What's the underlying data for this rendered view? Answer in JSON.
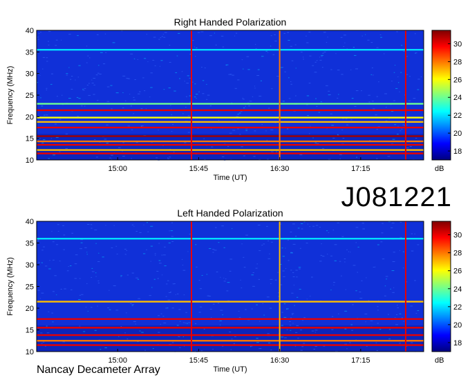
{
  "source_id": "J081221",
  "instrument": "Nancay Decameter Array",
  "colors": {
    "scale": [
      "#00007f",
      "#0000ff",
      "#007fff",
      "#00ffff",
      "#7fff7f",
      "#ffff00",
      "#ff7f00",
      "#ff0000",
      "#7f0000"
    ]
  },
  "chart_data": [
    {
      "type": "heatmap",
      "title": "Right Handed Polarization",
      "xlabel": "Time (UT)",
      "ylabel": "Frequency (MHz)",
      "x_ticks": [
        "15:00",
        "15:45",
        "16:30",
        "17:15"
      ],
      "y_ticks": [
        "40",
        "35",
        "30",
        "25",
        "20",
        "15",
        "10"
      ],
      "ylim": [
        10,
        40
      ],
      "colorbar": {
        "label": "dB",
        "ticks": [
          "30",
          "28",
          "26",
          "24",
          "22",
          "20",
          "18"
        ],
        "range": [
          17,
          31.5
        ]
      },
      "bands": [
        {
          "freq": 11.5,
          "level": 30
        },
        {
          "freq": 12.3,
          "level": 27
        },
        {
          "freq": 13.5,
          "level": 30
        },
        {
          "freq": 14.3,
          "level": 28
        },
        {
          "freq": 15.5,
          "level": 31
        },
        {
          "freq": 17.5,
          "level": 30
        },
        {
          "freq": 18.8,
          "level": 27
        },
        {
          "freq": 19.8,
          "level": 26
        },
        {
          "freq": 21.5,
          "level": 30
        },
        {
          "freq": 23.0,
          "level": 24
        },
        {
          "freq": 35.5,
          "level": 22
        }
      ],
      "bursts": [
        {
          "time": "15:41",
          "level": 30
        },
        {
          "time": "16:30",
          "level": 28
        },
        {
          "time": "17:40",
          "level": 30
        }
      ]
    },
    {
      "type": "heatmap",
      "title": "Left Handed Polarization",
      "xlabel": "Time (UT)",
      "ylabel": "Frequency (MHz)",
      "x_ticks": [
        "15:00",
        "15:45",
        "16:30",
        "17:15"
      ],
      "y_ticks": [
        "40",
        "35",
        "30",
        "25",
        "20",
        "15",
        "10"
      ],
      "ylim": [
        10,
        40
      ],
      "colorbar": {
        "label": "dB",
        "ticks": [
          "30",
          "28",
          "26",
          "24",
          "22",
          "20",
          "18"
        ],
        "range": [
          17,
          31.5
        ]
      },
      "bands": [
        {
          "freq": 11.5,
          "level": 30
        },
        {
          "freq": 12.5,
          "level": 28
        },
        {
          "freq": 13.8,
          "level": 30
        },
        {
          "freq": 15.5,
          "level": 30
        },
        {
          "freq": 17.5,
          "level": 30
        },
        {
          "freq": 21.5,
          "level": 27
        },
        {
          "freq": 36.0,
          "level": 22
        }
      ],
      "bursts": [
        {
          "time": "15:41",
          "level": 30
        },
        {
          "time": "16:30",
          "level": 27
        },
        {
          "time": "17:40",
          "level": 30
        }
      ]
    }
  ]
}
